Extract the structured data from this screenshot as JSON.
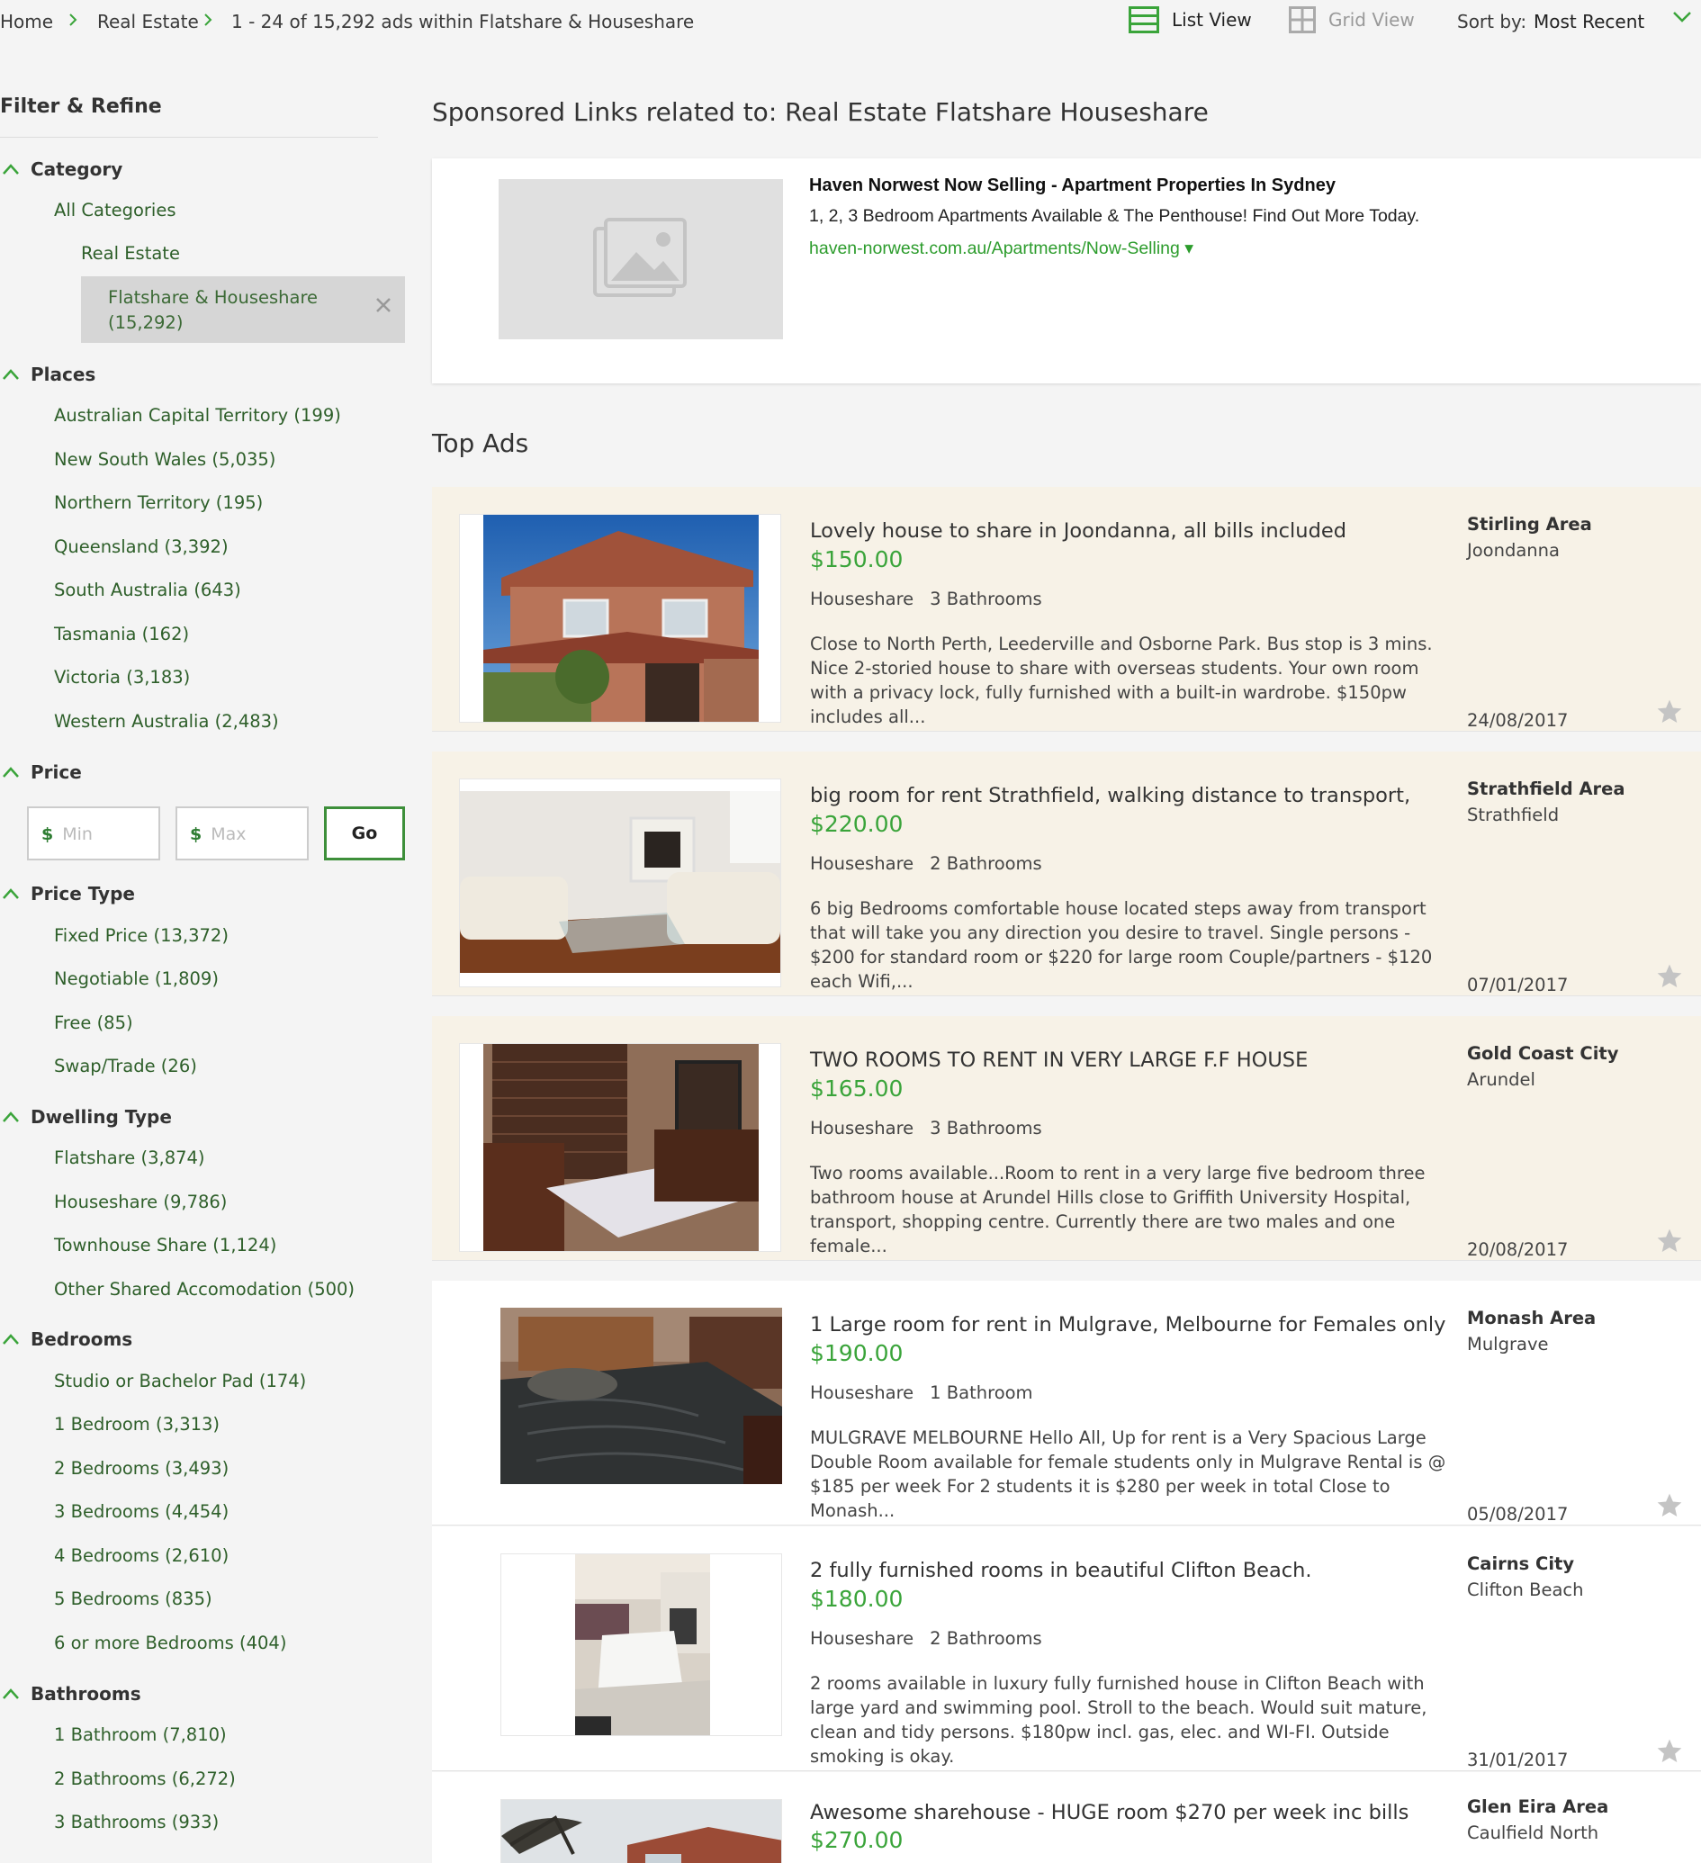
{
  "breadcrumb": {
    "home": "Home",
    "category": "Real Estate",
    "results": "1 - 24 of 15,292 ads within Flatshare & Houseshare"
  },
  "view": {
    "list": "List View",
    "grid": "Grid View",
    "active": "list"
  },
  "sort": {
    "label": "Sort by:",
    "value": "Most Recent"
  },
  "colors": {
    "accent": "#3aa43a",
    "link": "#2e5f2a",
    "top_ad_bg": "#f7f2e7"
  },
  "filters": {
    "title": "Filter & Refine",
    "category": {
      "title": "Category",
      "all": "All Categories",
      "parent": "Real Estate",
      "selected": "Flatshare & Houseshare",
      "selected_count": "(15,292)"
    },
    "places": {
      "title": "Places",
      "items": [
        "Australian Capital Territory (199)",
        "New South Wales (5,035)",
        "Northern Territory (195)",
        "Queensland (3,392)",
        "South Australia (643)",
        "Tasmania (162)",
        "Victoria (3,183)",
        "Western Australia (2,483)"
      ]
    },
    "price": {
      "title": "Price",
      "currency": "$",
      "min_placeholder": "Min",
      "max_placeholder": "Max",
      "go": "Go"
    },
    "price_type": {
      "title": "Price Type",
      "items": [
        "Fixed Price (13,372)",
        "Negotiable (1,809)",
        "Free (85)",
        "Swap/Trade (26)"
      ]
    },
    "dwelling_type": {
      "title": "Dwelling Type",
      "items": [
        "Flatshare (3,874)",
        "Houseshare (9,786)",
        "Townhouse Share (1,124)",
        "Other Shared Accomodation (500)"
      ]
    },
    "bedrooms": {
      "title": "Bedrooms",
      "items": [
        "Studio or Bachelor Pad (174)",
        "1 Bedroom (3,313)",
        "2 Bedrooms (3,493)",
        "3 Bedrooms (4,454)",
        "4 Bedrooms (2,610)",
        "5 Bedrooms (835)",
        "6 or more Bedrooms (404)"
      ]
    },
    "bathrooms": {
      "title": "Bathrooms",
      "items": [
        "1 Bathroom (7,810)",
        "2 Bathrooms (6,272)",
        "3 Bathrooms (933)"
      ]
    }
  },
  "sponsored": {
    "heading": "Sponsored Links related to: Real Estate Flatshare Houseshare",
    "title": "Haven Norwest Now Selling - Apartment Properties In Sydney",
    "description": "1, 2, 3 Bedroom Apartments Available & The Penthouse! Find Out More Today.",
    "url": "haven-norwest.com.au/Apartments/Now-Selling ▾"
  },
  "top_ads_heading": "Top Ads",
  "listings": [
    {
      "title": "Lovely house to share in Joondanna, all bills included",
      "price": "$150.00",
      "type": "Houseshare",
      "bathrooms": "3 Bathrooms",
      "description": "Close to North Perth, Leederville and Osborne Park. Bus stop is 3 mins. Nice 2-storied house to share with overseas students. Your own room with a privacy lock, fully furnished with a built-in wardrobe. $150pw includes all...",
      "area": "Stirling Area",
      "suburb": "Joondanna",
      "date": "24/08/2017",
      "featured": true
    },
    {
      "title": "big room for rent Strathfield, walking distance to transport,",
      "price": "$220.00",
      "type": "Houseshare",
      "bathrooms": "2 Bathrooms",
      "description": "6 big Bedrooms comfortable house located steps away from transport that will take you any direction you desire to travel. Single persons - $200 for standard room or $220 for large room Couple/partners - $120 each Wifi,...",
      "area": "Strathfield Area",
      "suburb": "Strathfield",
      "date": "07/01/2017",
      "featured": true
    },
    {
      "title": "TWO ROOMS TO RENT IN VERY LARGE F.F HOUSE",
      "price": "$165.00",
      "type": "Houseshare",
      "bathrooms": "3 Bathrooms",
      "description": "Two rooms available...Room to rent in a very large five bedroom three bathroom house at Arundel Hills close to Griffith University Hospital, transport, shopping centre. Currently there are two males and one female...",
      "area": "Gold Coast City",
      "suburb": "Arundel",
      "date": "20/08/2017",
      "featured": true
    },
    {
      "title": "1 Large room for rent in Mulgrave, Melbourne for Females only",
      "price": "$190.00",
      "type": "Houseshare",
      "bathrooms": "1 Bathroom",
      "description": "MULGRAVE MELBOURNE Hello All, Up for rent is a Very Spacious Large Double Room available for female students only in Mulgrave Rental is @ $185 per week For 2 students it is $280 per week in total Close to Monash...",
      "area": "Monash Area",
      "suburb": "Mulgrave",
      "date": "05/08/2017",
      "featured": false
    },
    {
      "title": "2 fully furnished rooms in beautiful Clifton Beach.",
      "price": "$180.00",
      "type": "Houseshare",
      "bathrooms": "2 Bathrooms",
      "description": "2 rooms available in luxury fully furnished house in Clifton Beach with large yard and swimming pool. Stroll to the beach. Would suit mature, clean and tidy persons. $180pw incl. gas, elec. and WI-FI. Outside smoking is okay.",
      "area": "Cairns City",
      "suburb": "Clifton Beach",
      "date": "31/01/2017",
      "featured": false
    },
    {
      "title": "Awesome sharehouse - HUGE room $270 per week inc bills",
      "price": "$270.00",
      "area": "Glen Eira Area",
      "suburb": "Caulfield North",
      "featured": false
    }
  ]
}
